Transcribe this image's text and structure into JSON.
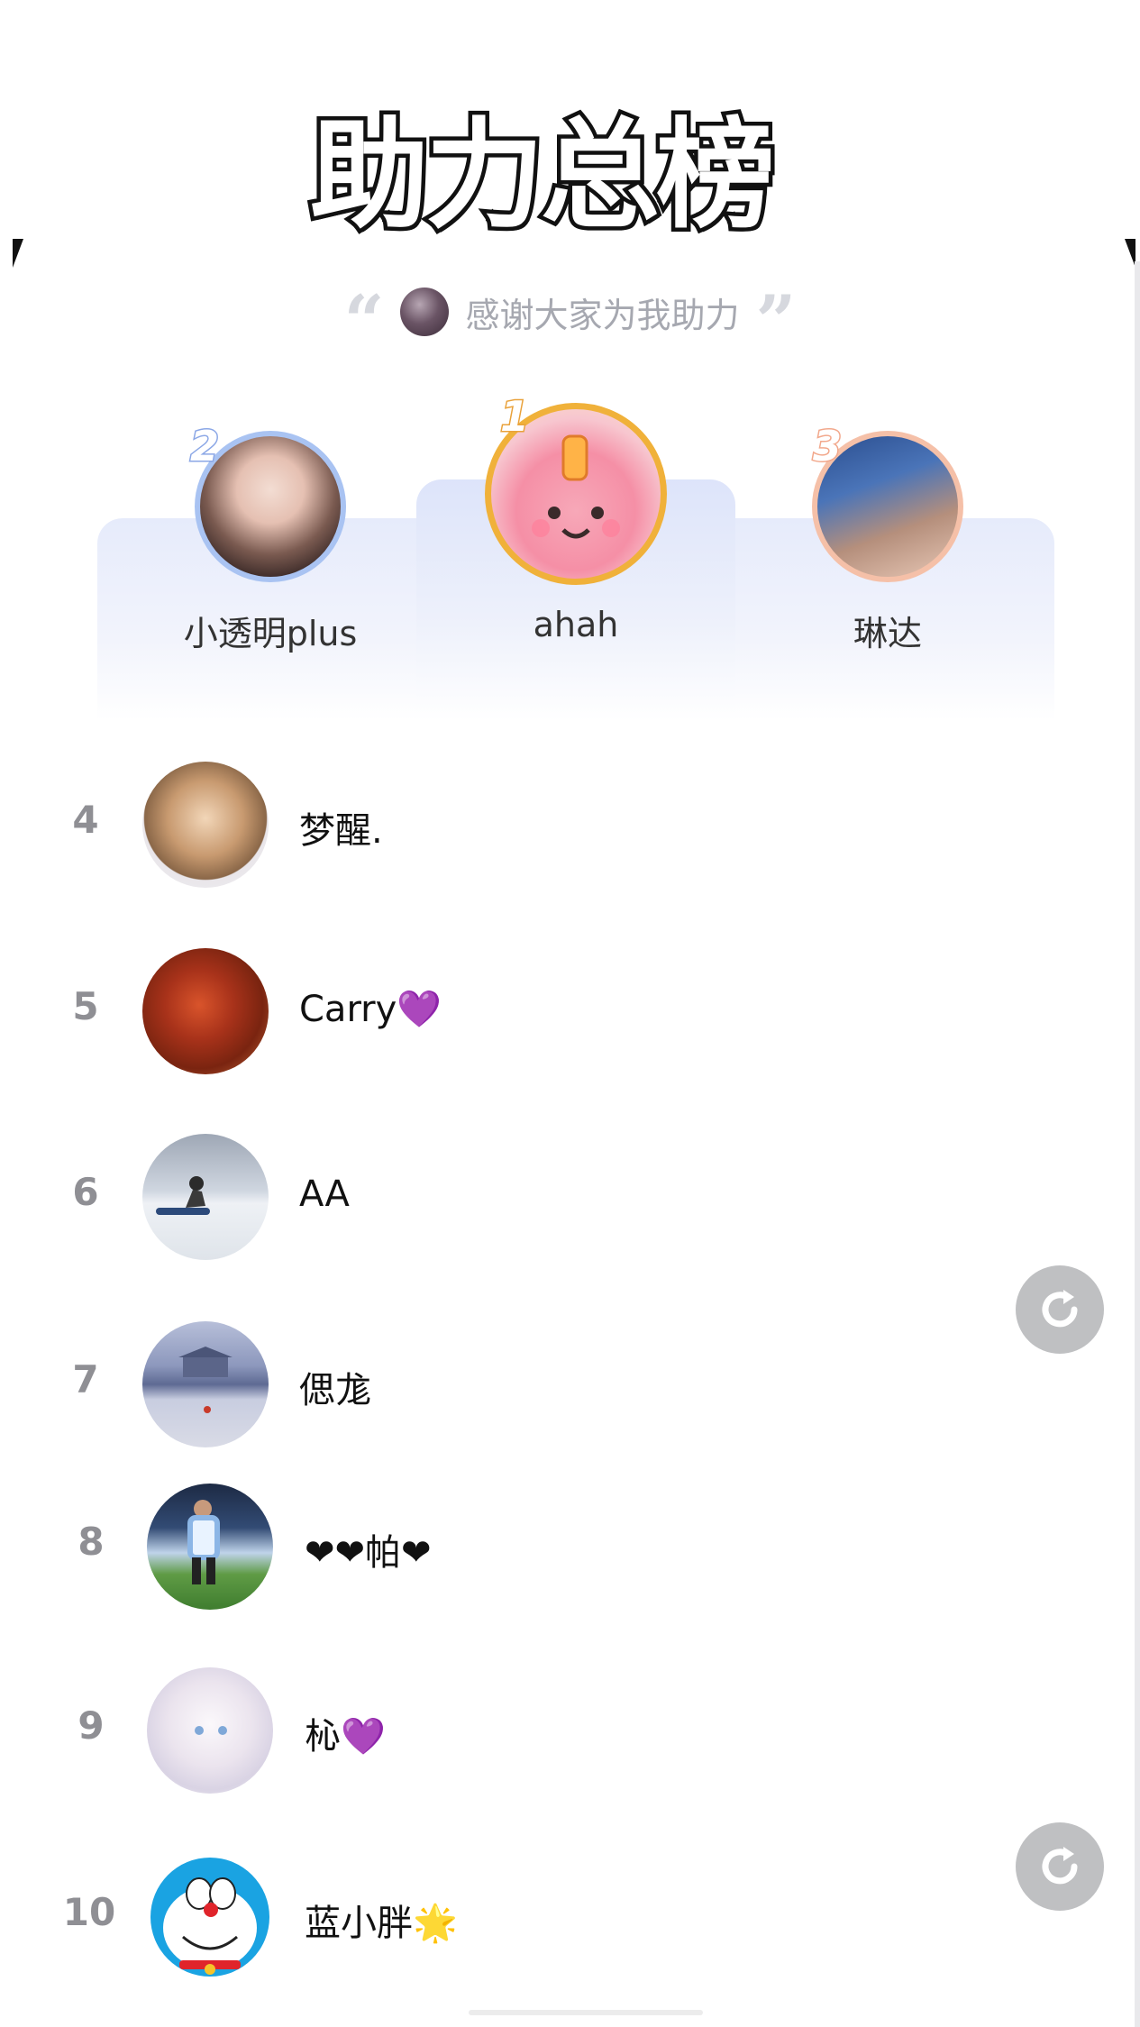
{
  "title": "助力总榜",
  "thanks_text": "感谢大家为我助力",
  "top3": [
    {
      "rank": "2",
      "name": "小透明plus"
    },
    {
      "rank": "1",
      "name": "ahah"
    },
    {
      "rank": "3",
      "name": "琳达"
    }
  ],
  "list": [
    {
      "rank": "4",
      "name": "梦醒."
    },
    {
      "rank": "5",
      "name": "Carry💜"
    },
    {
      "rank": "6",
      "name": "AA"
    },
    {
      "rank": "7",
      "name": "偲尨"
    },
    {
      "rank": "8",
      "name": "❤❤帕❤"
    },
    {
      "rank": "9",
      "name": "杺💜"
    },
    {
      "rank": "10",
      "name": "蓝小胖🌟"
    }
  ],
  "colors": {
    "rank_gray": "#8f8f94",
    "podium_blue": "#dde4fa",
    "gold_ring": "#f0b13a",
    "refresh_gray": "#bfc0c2"
  },
  "icons": [
    "open-quote-icon",
    "close-quote-icon",
    "refresh-icon"
  ]
}
